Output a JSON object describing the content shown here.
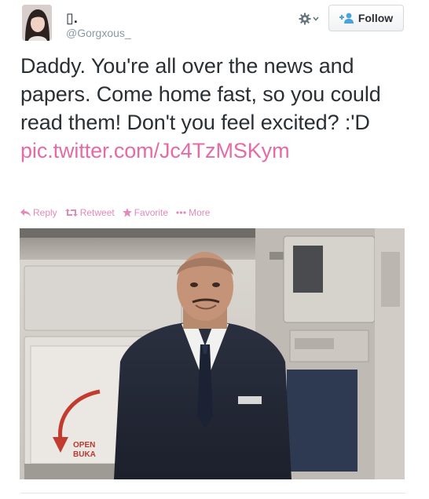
{
  "header": {
    "display_name": "▯.",
    "screen_name": "@Gorgxous_",
    "follow_label": "Follow"
  },
  "tweet": {
    "text": "Daddy. You're all over the news and papers. Come home fast, so you could read them! Don't you feel excited? :'D",
    "link": "pic.twitter.com/Jc4TzMSKym"
  },
  "actions": {
    "reply": "Reply",
    "retweet": "Retweet",
    "favorite": "Favorite",
    "more": "More"
  },
  "photo": {
    "sign_line1": "OPEN",
    "sign_line2": "BUKA"
  },
  "colors": {
    "link": "#e56ba6",
    "action": "#e38ab9",
    "follow_icon": "#4aa3df",
    "text": "#292f33",
    "muted": "#8899a6"
  },
  "icons": [
    "gear-icon",
    "chevron-down-icon",
    "add-user-icon",
    "reply-icon",
    "retweet-icon",
    "star-icon",
    "more-dots-icon"
  ]
}
